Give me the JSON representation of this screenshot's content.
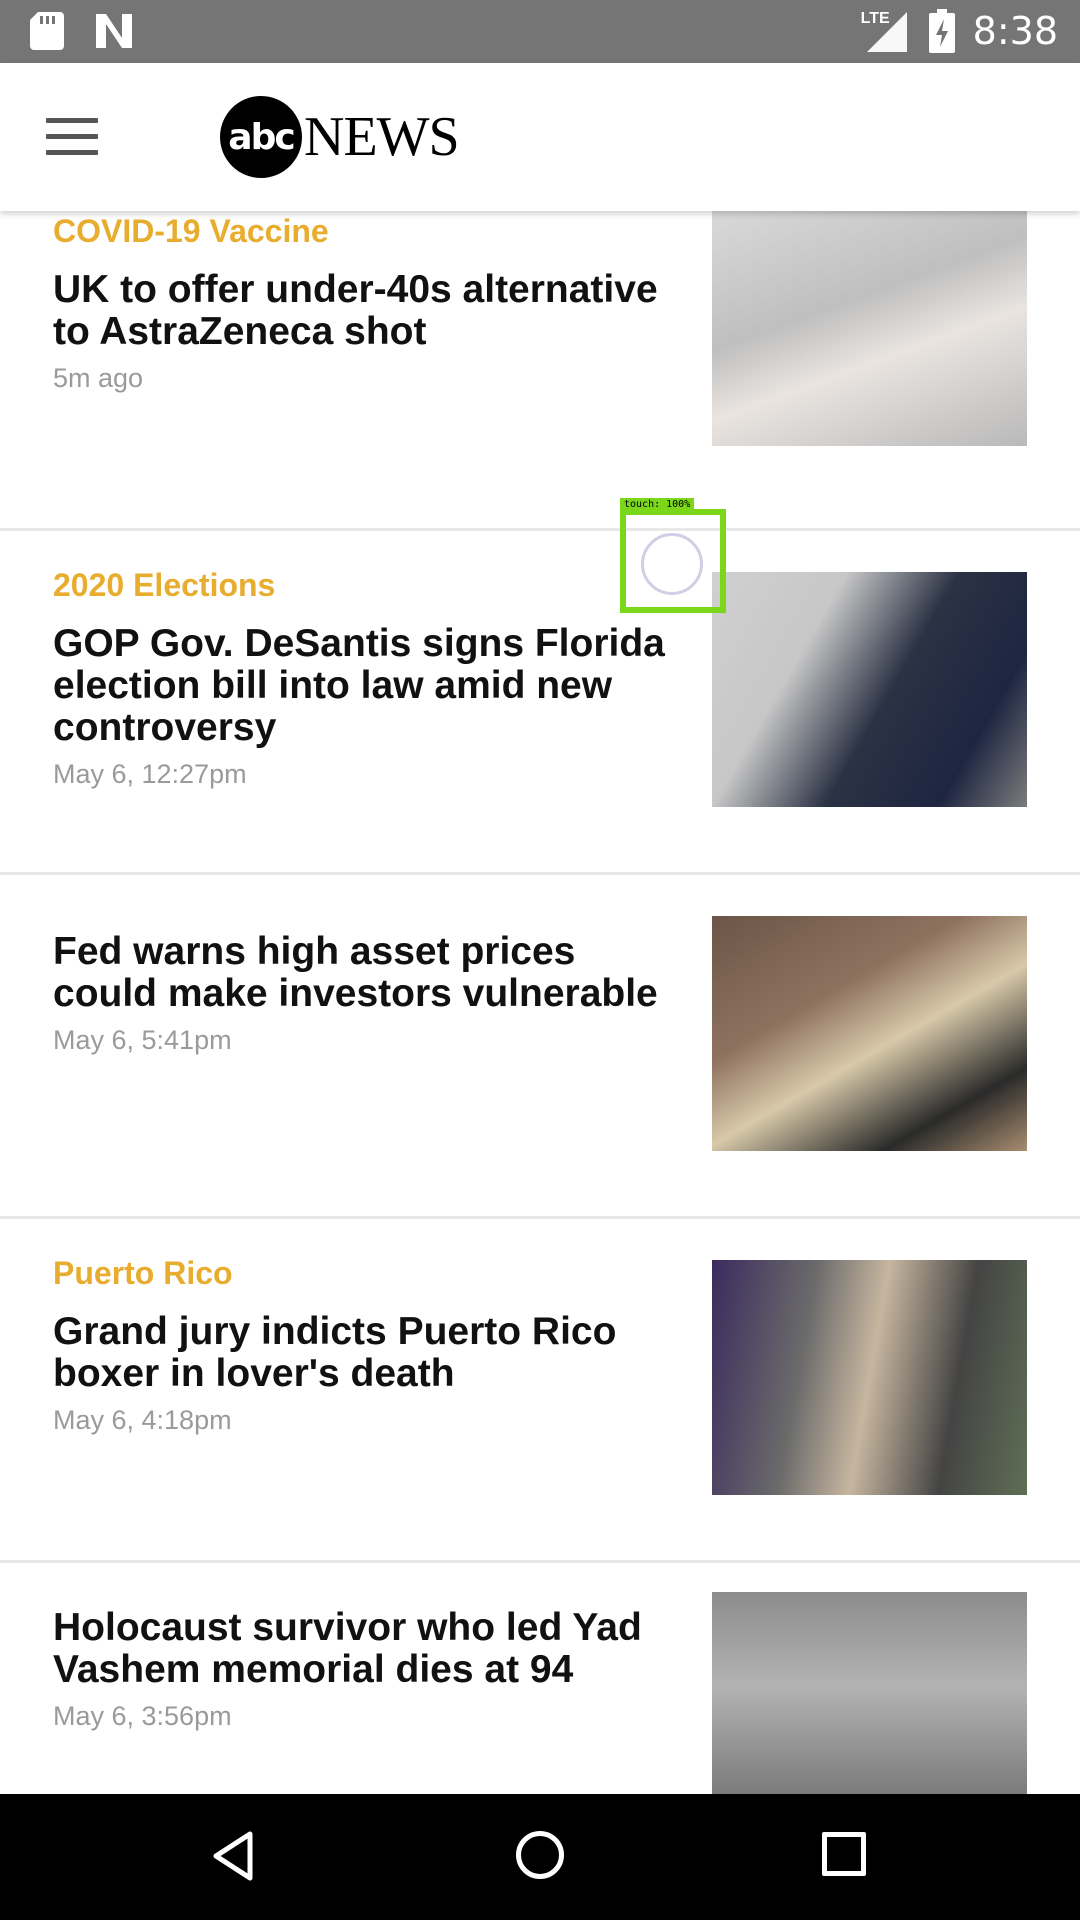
{
  "status_bar": {
    "time": "8:38",
    "network": "LTE",
    "icons": [
      "sd-card-icon",
      "n-notification-icon",
      "lte-signal-icon",
      "battery-charging-icon"
    ]
  },
  "app_bar": {
    "logo_abc": "abc",
    "logo_news": "NEWS",
    "icons": [
      "menu-icon"
    ]
  },
  "articles": [
    {
      "category": "COVID-19 Vaccine",
      "headline": "UK to offer under-40s alternative to AstraZeneca shot",
      "time": "5m ago"
    },
    {
      "category": "2020 Elections",
      "headline": "GOP Gov. DeSantis signs Florida election bill into law amid new controversy",
      "time": "May 6, 12:27pm"
    },
    {
      "category": "",
      "headline": "Fed warns high asset prices could make investors vulnerable",
      "time": "May 6, 5:41pm"
    },
    {
      "category": "Puerto Rico",
      "headline": "Grand jury indicts Puerto Rico boxer in lover's death",
      "time": "May 6, 4:18pm"
    },
    {
      "category": "",
      "headline": "Holocaust survivor who led Yad Vashem memorial dies at 94",
      "time": "May 6, 3:56pm"
    }
  ],
  "touch_overlay": {
    "label": "touch: 100%",
    "color": "#7ad71a"
  },
  "colors": {
    "category_accent": "#e8ac2e",
    "status_bar": "#757575",
    "nav_bar": "#000000"
  },
  "nav_bar": {
    "icons": [
      "back-icon",
      "home-icon",
      "recent-apps-icon"
    ]
  }
}
